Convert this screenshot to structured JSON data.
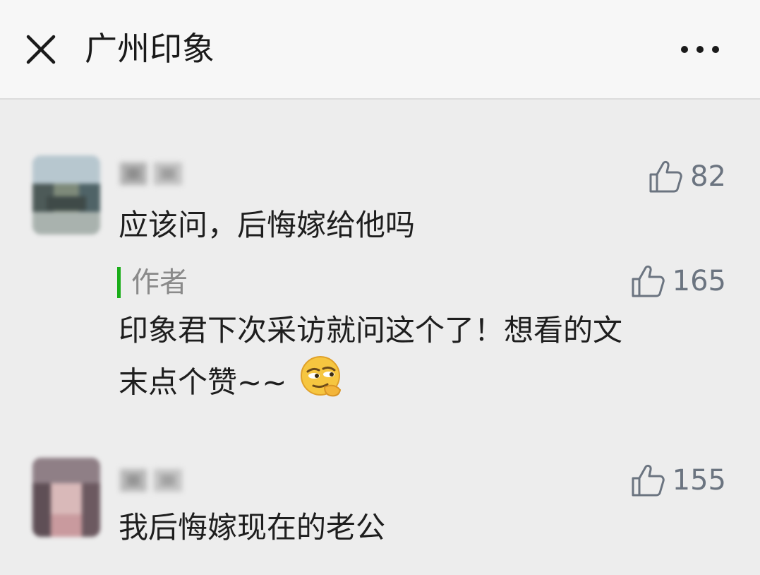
{
  "header": {
    "title": "广州印象",
    "close_icon": "close-icon",
    "more_icon": "more-dots-icon"
  },
  "comments": [
    {
      "text": "应该问，后悔嫁给他吗",
      "likes": "82",
      "reply": {
        "author_label": "作者",
        "likes": "165",
        "line1": "印象君下次采访就问这个了！想看的文",
        "line2": "末点个赞~~",
        "emoji": "smirk-emoji"
      }
    },
    {
      "text": "我后悔嫁现在的老公",
      "likes": "155"
    }
  ],
  "colors": {
    "background": "#ededed",
    "header_bg": "#f7f7f7",
    "author_accent": "#1aad19",
    "like_icon": "#6b7480"
  }
}
